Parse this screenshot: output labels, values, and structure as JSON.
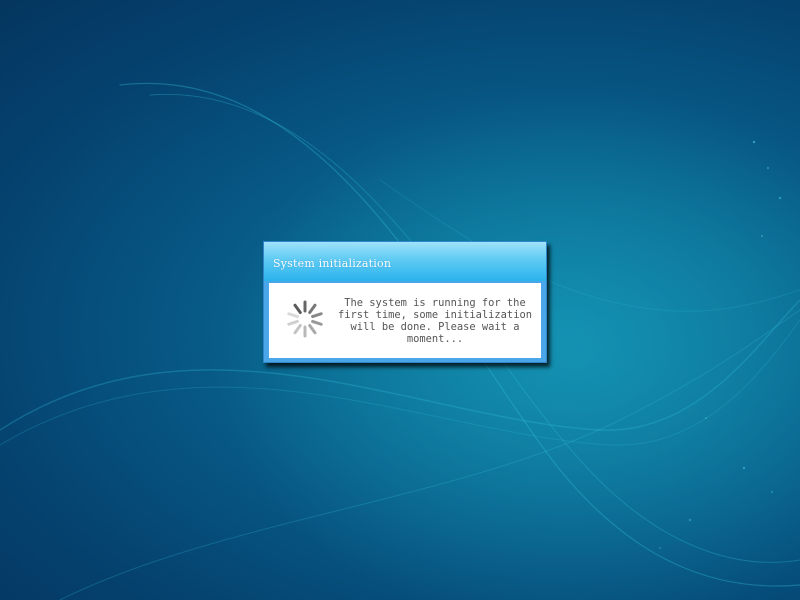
{
  "desktop": {
    "background_colors": [
      "#04365f",
      "#0a6c93",
      "#0d7fa3"
    ]
  },
  "dialog": {
    "title": "System initialization",
    "message": "The system is running for the first time, some initialization will be done. Please wait a moment...",
    "spinner_icon": "loading-spinner-icon",
    "accent_color": "#2ab3ec"
  }
}
